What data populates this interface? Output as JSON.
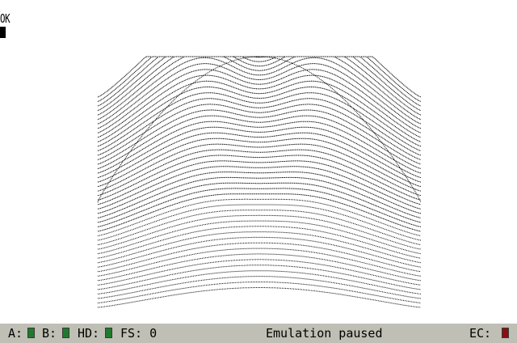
{
  "screen": {
    "prompt_text": "OK"
  },
  "statusbar": {
    "drive_a_label": "A:",
    "drive_b_label": "B:",
    "drive_hd_label": "HD:",
    "fs_label": "FS: 0",
    "status_message": "Emulation paused",
    "rec_label": "EC:",
    "colors": {
      "background": "#bfbfb5",
      "drive_led": "#1f7a2e",
      "rec_led": "#8a1010"
    }
  }
}
